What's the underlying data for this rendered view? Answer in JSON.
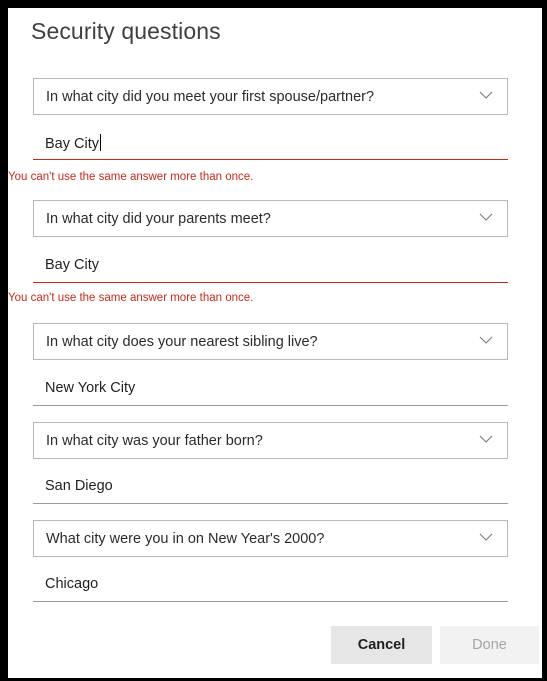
{
  "dialog": {
    "title": "Security questions",
    "questions": [
      {
        "question": "In what city did you meet your first spouse/partner?",
        "answer": "Bay City",
        "error": "You can't use the same answer more than once."
      },
      {
        "question": "In what city did your parents meet?",
        "answer": "Bay City",
        "error": "You can't use the same answer more than once."
      },
      {
        "question": "In what city does your nearest sibling live?",
        "answer": "New York City",
        "error": ""
      },
      {
        "question": "In what city was your father born?",
        "answer": "San Diego",
        "error": ""
      },
      {
        "question": "What city were you in on New Year's 2000?",
        "answer": "Chicago",
        "error": ""
      }
    ],
    "buttons": {
      "cancel": "Cancel",
      "done": "Done"
    }
  },
  "colors": {
    "error": "#c42b1c",
    "border": "#b8b8b8",
    "button_bg": "#e6e6e6",
    "disabled_text": "#a6a6a6"
  },
  "icons": {
    "dropdown": "chevron-down-icon"
  }
}
